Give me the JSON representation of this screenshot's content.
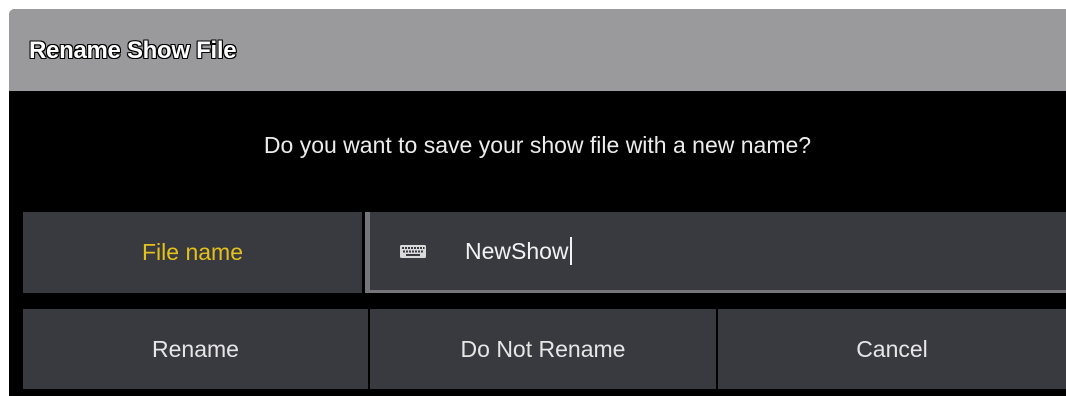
{
  "dialog": {
    "title": "Rename Show File",
    "message": "Do you want to save your show file with a new name?"
  },
  "field": {
    "label": "File name",
    "value": "NewShow",
    "icon": "keyboard-icon"
  },
  "buttons": {
    "rename": "Rename",
    "do_not_rename": "Do Not Rename",
    "cancel": "Cancel"
  },
  "colors": {
    "label_accent": "#e3c11c",
    "titlebar": "#9a9a9c",
    "cell_background": "#393940",
    "dialog_background": "#000000"
  }
}
